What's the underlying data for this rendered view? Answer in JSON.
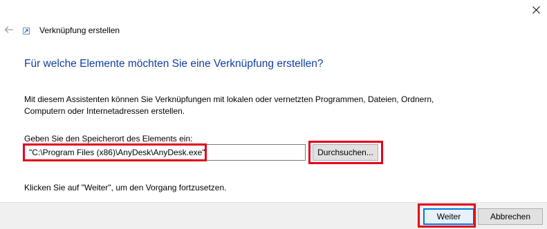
{
  "window": {
    "title": "Verknüpfung erstellen",
    "close_icon": "close-icon",
    "back_icon": "back-arrow-icon"
  },
  "wizard": {
    "heading": "Für welche Elemente möchten Sie eine Verknüpfung erstellen?",
    "description": "Mit diesem Assistenten können Sie Verknüpfungen mit lokalen oder vernetzten Programmen, Dateien, Ordnern, Computern oder Internetadressen erstellen.",
    "location_label": "Geben Sie den Speicherort des Elements ein:",
    "location_value": "\"C:\\Program Files (x86)\\AnyDesk\\AnyDesk.exe\"",
    "browse_label": "Durchsuchen...",
    "hint": "Klicken Sie auf \"Weiter\", um den Vorgang fortzusetzen."
  },
  "footer": {
    "next_label": "Weiter",
    "cancel_label": "Abbrechen"
  },
  "colors": {
    "heading": "#0f3fa0",
    "highlight": "#e3001b",
    "accent": "#0078d7"
  }
}
